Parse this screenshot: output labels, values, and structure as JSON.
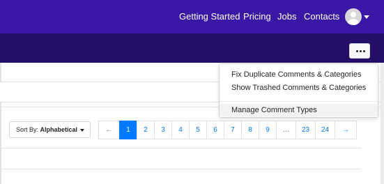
{
  "navbar": {
    "links": [
      "Getting Started",
      "Pricing",
      "Jobs",
      "Contacts"
    ],
    "colors": {
      "primary": "#3b17a6",
      "secondary": "#250e68"
    }
  },
  "toolbar": {
    "sort_prefix": "Sort By:",
    "sort_value": "Alphabetical"
  },
  "pagination": {
    "prev": "←",
    "pages": [
      "1",
      "2",
      "3",
      "4",
      "5",
      "6",
      "7",
      "8",
      "9",
      "…",
      "23",
      "24"
    ],
    "next": "→",
    "active": "1",
    "accent": "#007bff"
  },
  "menu": {
    "items": [
      "Fix Duplicate Comments & Categories",
      "Show Trashed Comments & Categories",
      "Manage Comment Types"
    ]
  }
}
